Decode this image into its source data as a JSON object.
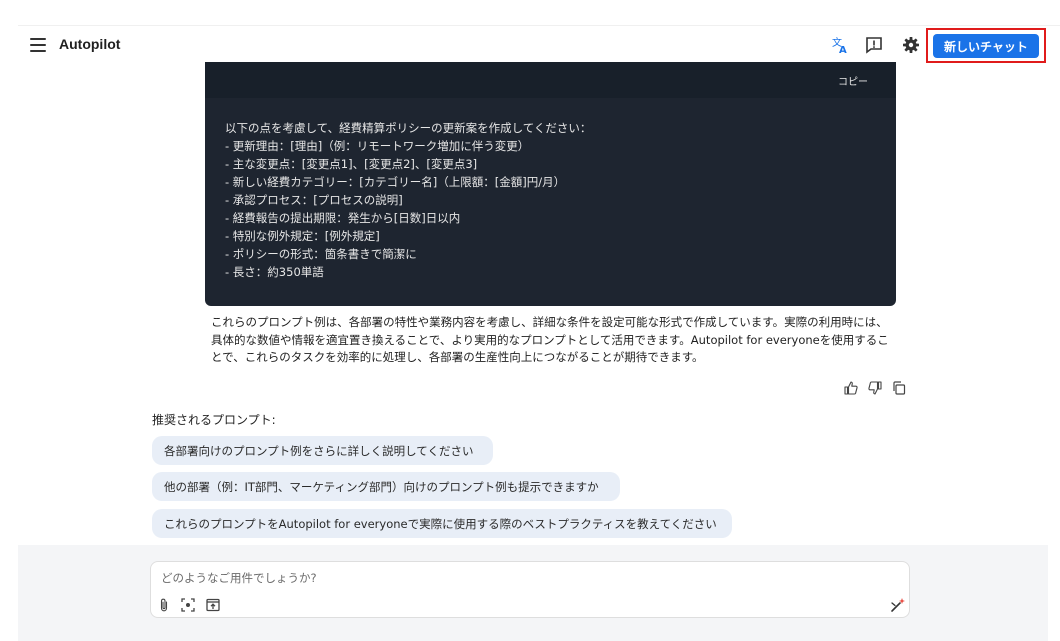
{
  "header": {
    "title": "Autopilot",
    "new_chat_label": "新しいチャット",
    "icons": [
      "menu-icon",
      "translate-icon",
      "feedback-icon",
      "gear-icon"
    ]
  },
  "code_block": {
    "copy_label": "コピー",
    "lines": [
      "以下の点を考慮して、経費精算ポリシーの更新案を作成してください：",
      "- 更新理由：[理由]（例：リモートワーク増加に伴う変更）",
      "- 主な変更点：[変更点1]、[変更点2]、[変更点3]",
      "- 新しい経費カテゴリー：[カテゴリー名]（上限額：[金額]円/月）",
      "- 承認プロセス：[プロセスの説明]",
      "- 経費報告の提出期限：発生から[日数]日以内",
      "- 特別な例外規定：[例外規定]",
      "- ポリシーの形式：箇条書きで簡潔に",
      "- 長さ：約350単語"
    ]
  },
  "answer": {
    "paragraph": "これらのプロンプト例は、各部署の特性や業務内容を考慮し、詳細な条件を設定可能な形式で作成しています。実際の利用時には、具体的な数値や情報を適宜置き換えることで、より実用的なプロンプトとして活用できます。Autopilot for everyoneを使用することで、これらのタスクを効率的に処理し、各部署の生産性向上につながることが期待できます。"
  },
  "suggestions": {
    "title": "推奨されるプロンプト:",
    "items": [
      "各部署向けのプロンプト例をさらに詳しく説明してください",
      "他の部署（例：IT部門、マーケティング部門）向けのプロンプト例も提示できますか",
      "これらのプロンプトをAutopilot for everyoneで実際に使用する際のベストプラクティスを教えてください"
    ]
  },
  "composer": {
    "placeholder": "どのようなご用件でしょうか?"
  },
  "colors": {
    "accent": "#1a73e8",
    "highlight_border": "#e01b1b",
    "code_bg": "#1e2530",
    "chip_bg": "#e8eef7"
  }
}
